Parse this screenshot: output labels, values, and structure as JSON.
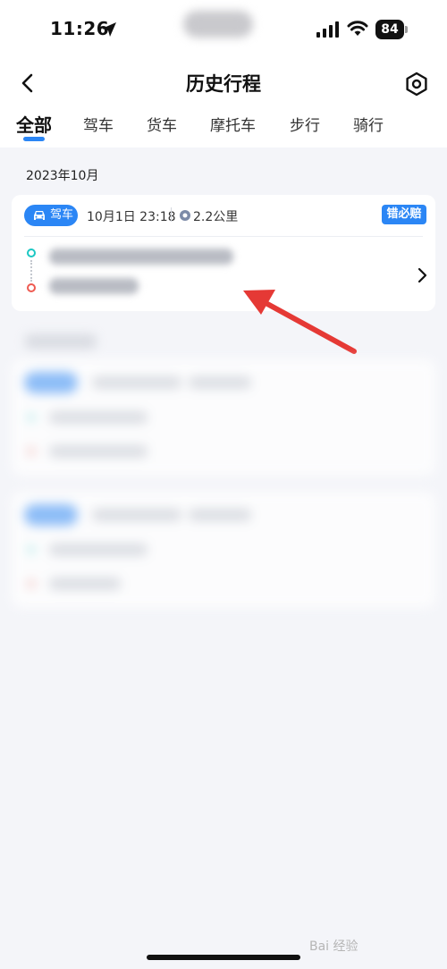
{
  "status_bar": {
    "time": "11:26",
    "battery": "84",
    "icons": [
      "location-arrow-icon",
      "signal-icon",
      "wifi-icon",
      "battery-icon"
    ]
  },
  "header": {
    "title": "历史行程",
    "back_icon": "chevron-left-icon",
    "settings_icon": "settings-hexagon-icon"
  },
  "tabs": [
    {
      "label": "全部",
      "active": true
    },
    {
      "label": "驾车",
      "active": false
    },
    {
      "label": "货车",
      "active": false
    },
    {
      "label": "摩托车",
      "active": false
    },
    {
      "label": "步行",
      "active": false
    },
    {
      "label": "骑行",
      "active": false
    }
  ],
  "month": "2023年10月",
  "trip": {
    "mode": "驾车",
    "datetime": "10月1日 23:18",
    "distance": "2.2公里",
    "claim_badge": "错必赔",
    "icons": [
      "car-icon",
      "distance-icon",
      "chevron-right-icon"
    ]
  },
  "watermark": "Bai 经验",
  "colors": {
    "accent": "#2b86f5",
    "background": "#f4f5f9",
    "start_dot": "#1bc7c3",
    "end_dot": "#ee5a51",
    "annotation": "#e53935"
  }
}
